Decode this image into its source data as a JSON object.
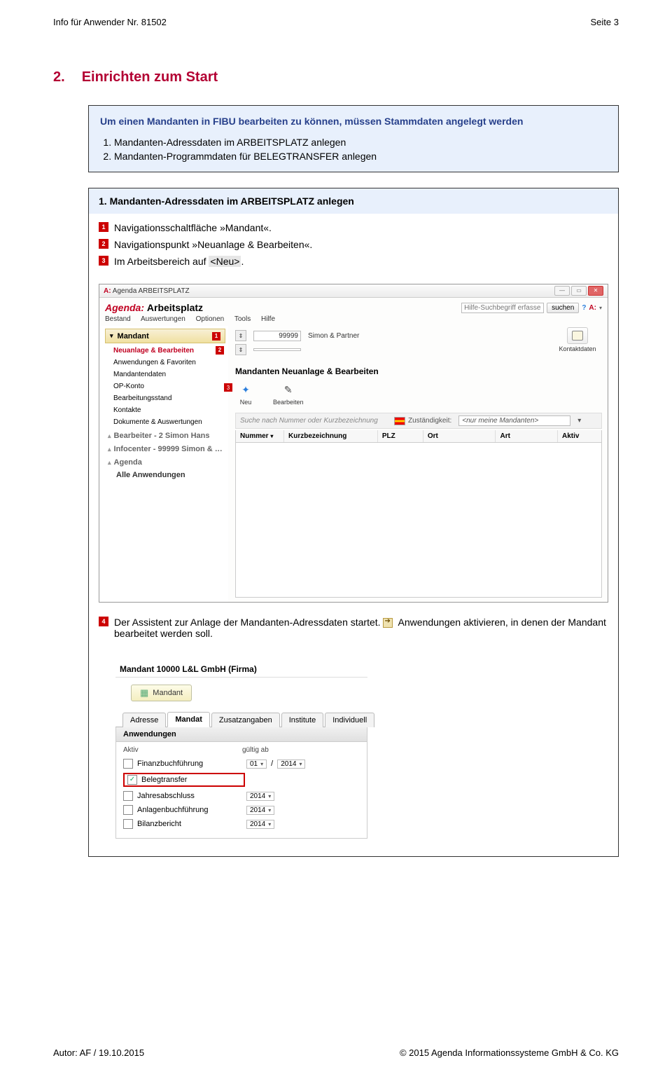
{
  "header": {
    "left": "Info für Anwender Nr. 81502",
    "right": "Seite 3"
  },
  "footer": {
    "left": "Autor: AF / 19.10.2015",
    "right": "© 2015 Agenda Informationssysteme GmbH & Co. KG"
  },
  "section": {
    "num": "2.",
    "title": "Einrichten zum Start"
  },
  "intro": {
    "lead": "Um einen Mandanten in FIBU bearbeiten zu können, müssen Stammdaten angelegt werden",
    "items": [
      "Mandanten-Adressdaten im ARBEITSPLATZ anlegen",
      "Mandanten-Programmdaten für BELEGTRANSFER anlegen"
    ]
  },
  "steps": {
    "title": "1. Mandanten-Adressdaten im ARBEITSPLATZ anlegen",
    "s1": "Navigationsschaltfläche »Mandant«.",
    "s2": "Navigationspunkt »Neuanlage & Bearbeiten«.",
    "s3_a": "Im Arbeitsbereich auf ",
    "s3_b": "<Neu>",
    "s3_c": ".",
    "s4_a": "Der Assistent zur Anlage der Mandanten-Adressdaten startet. ",
    "s4_b": " Anwendungen aktivieren, in denen der Mandant bearbeitet werden soll."
  },
  "shot1": {
    "win_prefix": "A:",
    "win_title": "Agenda ARBEITSPLATZ",
    "brand": "Agenda:",
    "brand_sub": "Arbeitsplatz",
    "search_ph": "Hilfe-Suchbegriff erfassen…",
    "search_btn": "suchen",
    "menu": [
      "Bestand",
      "Auswertungen",
      "Optionen",
      "Tools",
      "Hilfe"
    ],
    "sidebar": {
      "mandant": "Mandant",
      "items": [
        "Neuanlage & Bearbeiten",
        "Anwendungen & Favoriten",
        "Mandantendaten",
        "OP-Konto",
        "Bearbeitungsstand",
        "Kontakte",
        "Dokumente & Auswertungen"
      ],
      "groups": [
        "Bearbeiter - 2 Simon Hans",
        "Infocenter - 99999 Simon & …",
        "Agenda"
      ],
      "all": "Alle Anwendungen"
    },
    "mand_num": "99999",
    "mand_name": "Simon & Partner",
    "kontakt": "Kontaktdaten",
    "main_title": "Mandanten Neuanlage & Bearbeiten",
    "act_neu": "Neu",
    "act_bearb": "Bearbeiten",
    "search_list": "Suche nach Nummer oder Kurzbezeichnung",
    "zust_label": "Zuständigkeit:",
    "zust_sel": "<nur meine Mandanten>",
    "cols": [
      "Nummer",
      "Kurzbezeichnung",
      "PLZ",
      "Ort",
      "Art",
      "Aktiv"
    ]
  },
  "shot2": {
    "title": "Mandant 10000  L&L GmbH (Firma)",
    "btn": "Mandant",
    "tabs": [
      "Adresse",
      "Mandat",
      "Zusatzangaben",
      "Institute",
      "Individuell"
    ],
    "section": "Anwendungen",
    "hdr_aktiv": "Aktiv",
    "hdr_gueltig": "gültig ab",
    "rows": [
      {
        "label": "Finanzbuchführung",
        "checked": false,
        "month": "01",
        "year": "2014"
      },
      {
        "label": "Belegtransfer",
        "checked": true,
        "highlight": true
      },
      {
        "label": "Jahresabschluss",
        "checked": false,
        "year": "2014"
      },
      {
        "label": "Anlagenbuchführung",
        "checked": false,
        "year": "2014"
      },
      {
        "label": "Bilanzbericht",
        "checked": false,
        "year": "2014"
      }
    ]
  }
}
